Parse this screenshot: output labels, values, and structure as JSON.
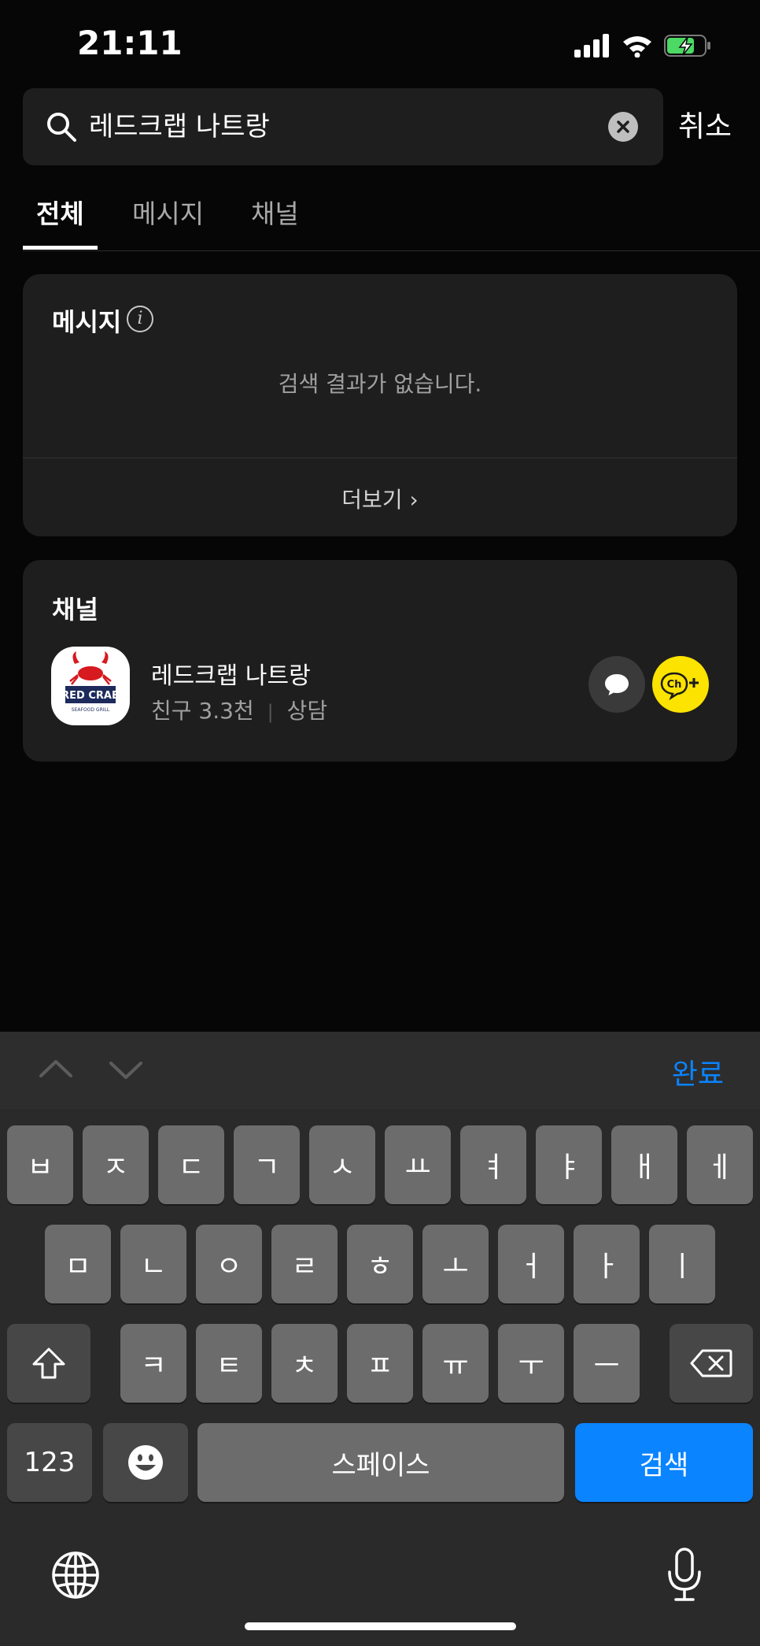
{
  "status": {
    "time": "21:11"
  },
  "search": {
    "query": "레드크랩 나트랑",
    "cancel_label": "취소"
  },
  "tabs": [
    {
      "label": "전체",
      "active": true
    },
    {
      "label": "메시지",
      "active": false
    },
    {
      "label": "채널",
      "active": false
    }
  ],
  "messages": {
    "title": "메시지",
    "empty_text": "검색 결과가 없습니다.",
    "more_label": "더보기 ›"
  },
  "channels": {
    "title": "채널",
    "item": {
      "name": "레드크랩 나트랑",
      "friends": "친구 3.3천",
      "separator": "|",
      "category": "상담",
      "logo_text": "RED CRAB",
      "logo_subtext": "SEAFOOD GRILL",
      "ch_badge": "Ch"
    }
  },
  "keyboard": {
    "done_label": "완료",
    "row1": [
      "ㅂ",
      "ㅈ",
      "ㄷ",
      "ㄱ",
      "ㅅ",
      "ㅛ",
      "ㅕ",
      "ㅑ",
      "ㅐ",
      "ㅔ"
    ],
    "row2": [
      "ㅁ",
      "ㄴ",
      "ㅇ",
      "ㄹ",
      "ㅎ",
      "ㅗ",
      "ㅓ",
      "ㅏ",
      "ㅣ"
    ],
    "row3": [
      "ㅋ",
      "ㅌ",
      "ㅊ",
      "ㅍ",
      "ㅠ",
      "ㅜ",
      "ㅡ"
    ],
    "numbers_label": "123",
    "space_label": "스페이스",
    "search_label": "검색"
  },
  "colors": {
    "accent": "#0a84ff",
    "channel_yellow": "#fce300",
    "battery_green": "#4cd964"
  }
}
